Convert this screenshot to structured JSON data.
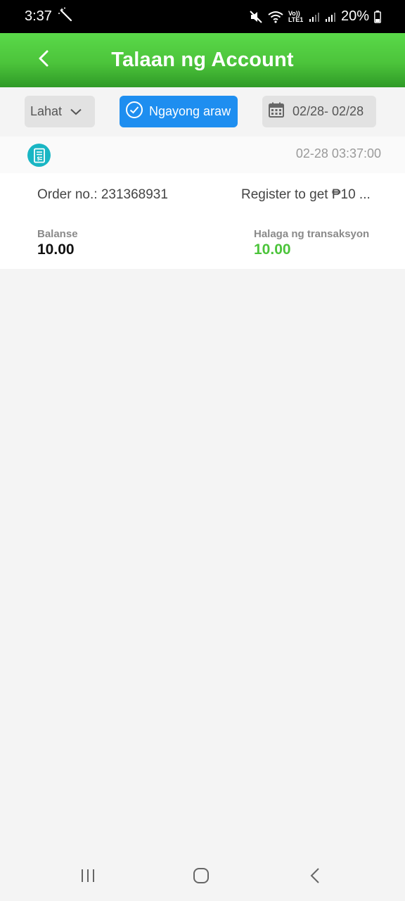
{
  "status_bar": {
    "time": "3:37",
    "network_label": "Vo)) LTE1",
    "battery": "20%"
  },
  "header": {
    "title": "Talaan ng Account"
  },
  "filters": {
    "all_label": "Lahat",
    "today_label": "Ngayong araw",
    "date_range": "02/28- 02/28"
  },
  "record": {
    "timestamp": "02-28 03:37:00",
    "order_no": "Order no.: 231368931",
    "note": "Register to get ₱10 ...",
    "balance_label": "Balanse",
    "balance_value": "10.00",
    "amount_label": "Halaga ng transaksyon",
    "amount_value": "10.00"
  },
  "colors": {
    "header_green": "#4cc43b",
    "accent_blue": "#1e8ef0",
    "amount_green": "#4cc43b",
    "receipt_teal": "#19b6c4"
  },
  "icons": {
    "back": "chevron-left-icon",
    "dropdown": "chevron-down-icon",
    "today_check": "check-circle-icon",
    "calendar": "calendar-icon",
    "receipt": "receipt-icon",
    "nav_recents": "recent-apps-icon",
    "nav_home": "home-icon",
    "nav_back": "nav-back-icon"
  }
}
